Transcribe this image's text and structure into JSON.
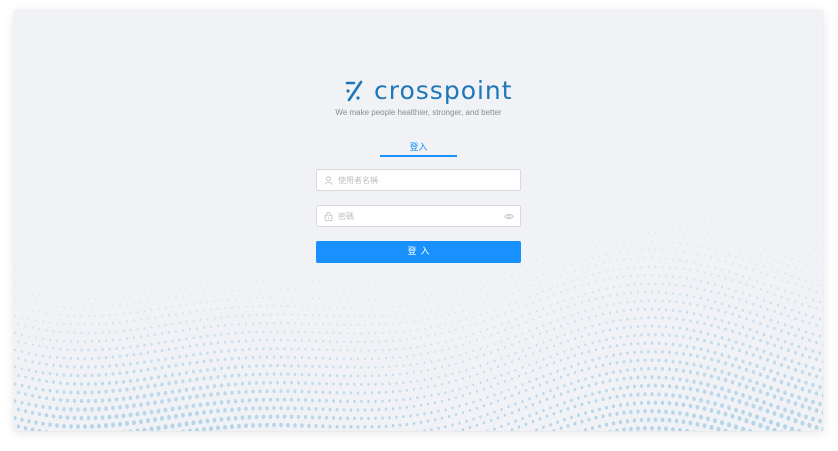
{
  "brand": {
    "name": "crosspoint",
    "tagline": "We make people healthier, stronger, and better",
    "logo_icon": "crosspoint-logo-mark"
  },
  "login": {
    "tab_label": "登入",
    "username_placeholder": "使用者名稱",
    "password_placeholder": "密碼",
    "submit_label": "登入",
    "username_icon": "user-icon",
    "password_icon": "lock-icon",
    "password_toggle_icon": "eye-icon"
  },
  "colors": {
    "background": "#f0f2f5",
    "brand": "#1d77b9",
    "primary": "#1890ff",
    "wave_dots": "#a9cfe7"
  }
}
